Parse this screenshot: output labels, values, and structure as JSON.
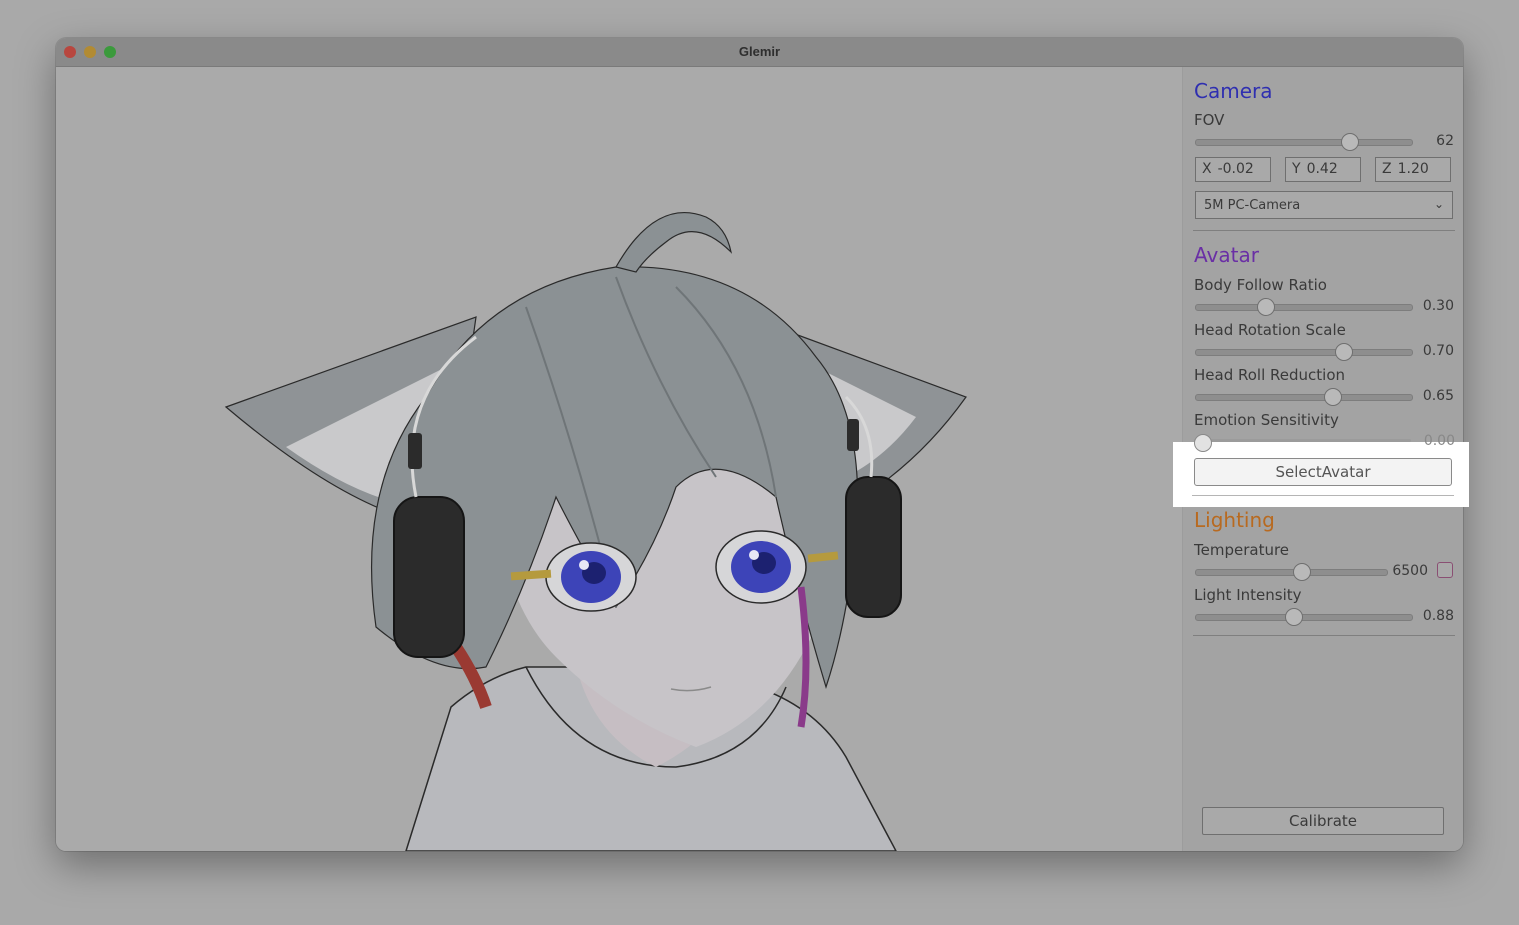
{
  "window": {
    "title": "Glemir"
  },
  "viewport": {
    "content": "avatar-preview"
  },
  "camera": {
    "title": "Camera",
    "title_color": "#2f2fb0",
    "fov_label": "FOV",
    "fov_value": "62",
    "fov_ratio": 0.71,
    "x_axis": "X",
    "x_value": "-0.02",
    "y_axis": "Y",
    "y_value": "0.42",
    "z_axis": "Z",
    "z_value": "1.20",
    "device": "5M PC-Camera"
  },
  "avatar": {
    "title": "Avatar",
    "title_color": "#6a2fa5",
    "sliders": [
      {
        "label": "Body Follow Ratio",
        "value": "0.30",
        "ratio": 0.32
      },
      {
        "label": "Head Rotation Scale",
        "value": "0.70",
        "ratio": 0.68
      },
      {
        "label": "Head Roll Reduction",
        "value": "0.65",
        "ratio": 0.63
      },
      {
        "label": "Emotion Sensitivity",
        "value": "0.00",
        "ratio": 0.0
      }
    ],
    "select_button": "SelectAvatar"
  },
  "lighting": {
    "title": "Lighting",
    "title_color": "#b86a20",
    "temperature_label": "Temperature",
    "temperature_value": "6500",
    "temperature_ratio": 0.55,
    "intensity_label": "Light Intensity",
    "intensity_value": "0.88",
    "intensity_ratio": 0.45
  },
  "footer": {
    "calibrate_button": "Calibrate"
  },
  "colors": {
    "backdrop": "#a9a9a9",
    "panel": "#a3a3a3",
    "highlight": "#ffffff"
  }
}
